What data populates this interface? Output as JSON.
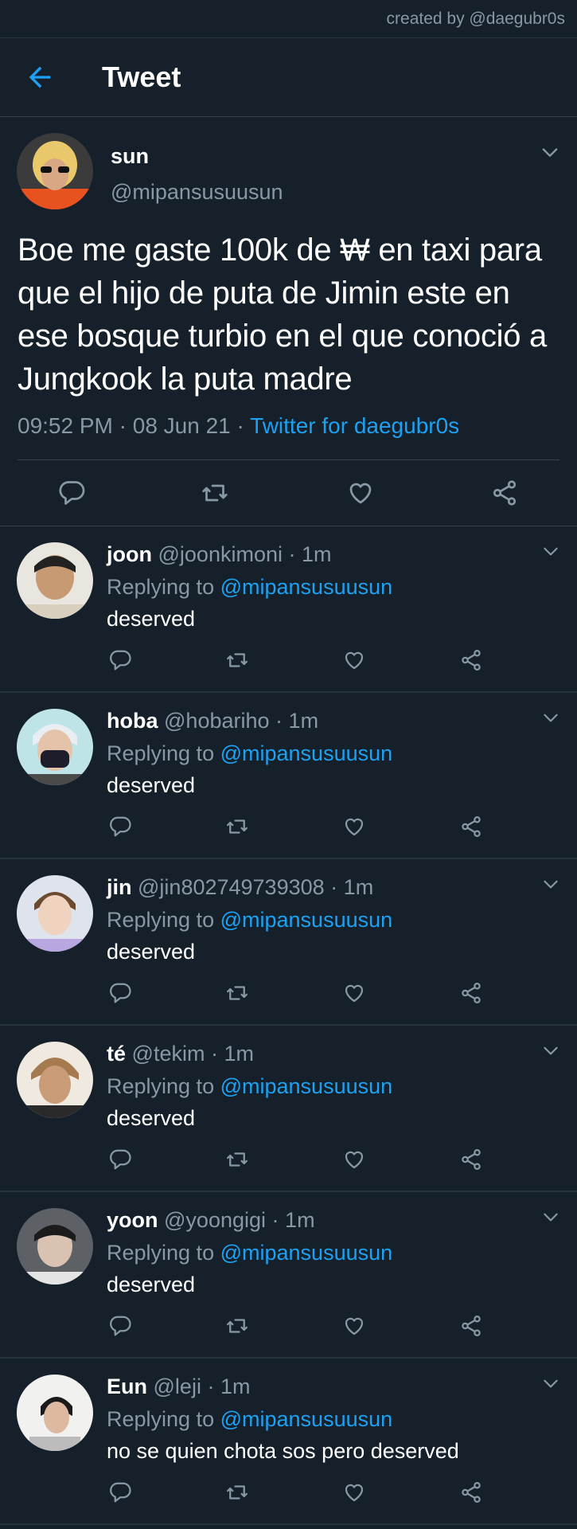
{
  "watermark": "created by @daegubr0s",
  "header": {
    "title": "Tweet"
  },
  "main_tweet": {
    "name": "sun",
    "handle": "@mipansusuusun",
    "text": "Boe me gaste 100k de ₩ en taxi para que el hijo de puta de Jimin este en ese bosque turbio en el que conoció a Jungkook la puta madre",
    "time": "09:52 PM",
    "date": "08 Jun 21",
    "source": "Twitter for daegubr0s"
  },
  "replies": [
    {
      "name": "joon",
      "handle": "@joonkimoni",
      "time": "1m",
      "replying_prefix": "Replying to",
      "mention": "@mipansusuusun",
      "text": "deserved"
    },
    {
      "name": "hoba",
      "handle": "@hobariho",
      "time": "1m",
      "replying_prefix": "Replying to",
      "mention": "@mipansusuusun",
      "text": "deserved"
    },
    {
      "name": "jin",
      "handle": "@jin802749739308",
      "time": "1m",
      "replying_prefix": "Replying to",
      "mention": "@mipansusuusun",
      "text": "deserved"
    },
    {
      "name": "té",
      "handle": "@tekim",
      "time": "1m",
      "replying_prefix": "Replying to",
      "mention": "@mipansusuusun",
      "text": "deserved"
    },
    {
      "name": "yoon",
      "handle": "@yoongigi",
      "time": "1m",
      "replying_prefix": "Replying to",
      "mention": "@mipansusuusun",
      "text": "deserved"
    },
    {
      "name": "Eun",
      "handle": "@leji",
      "time": "1m",
      "replying_prefix": "Replying to",
      "mention": "@mipansusuusun",
      "text": "no se quien chota sos pero deserved"
    }
  ],
  "sep": "·",
  "icons": [
    "back-arrow-icon",
    "chevron-down-icon",
    "reply-icon",
    "retweet-icon",
    "like-icon",
    "share-icon"
  ],
  "colors": {
    "background": "#15202b",
    "accent": "#1da1f2",
    "secondary_text": "#8899a6",
    "divider": "#38444d"
  }
}
